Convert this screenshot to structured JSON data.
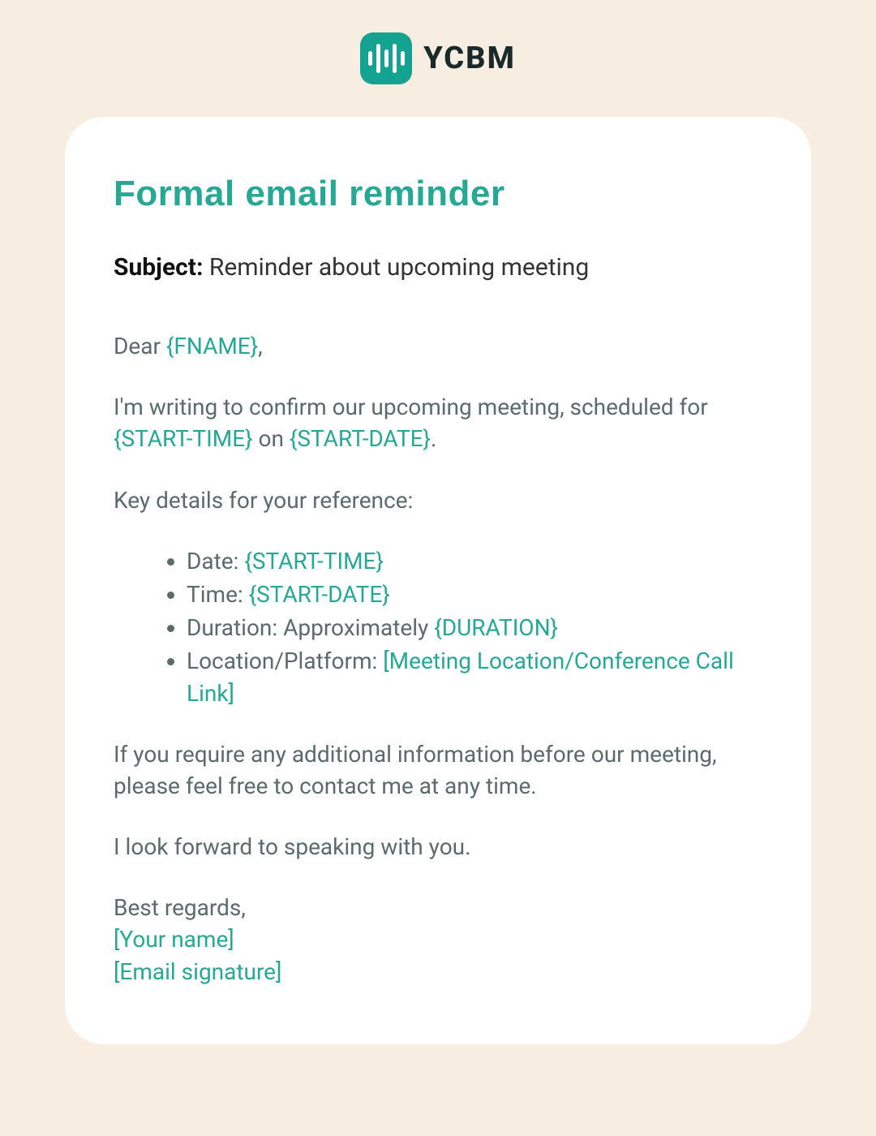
{
  "branding": {
    "name": "YCBM"
  },
  "heading": "Formal email reminder",
  "subject": {
    "label": "Subject:",
    "value": "Reminder about upcoming meeting"
  },
  "greeting": {
    "prefix": "Dear ",
    "token": "{FNAME}",
    "suffix": ","
  },
  "intro": {
    "part1": "I'm writing to confirm our upcoming meeting, scheduled for ",
    "token1": "{START-TIME}",
    "middle": " on ",
    "token2": "{START-DATE}",
    "suffix": "."
  },
  "details_intro": "Key details for your reference:",
  "details": {
    "date": {
      "label": "Date: ",
      "token": "{START-TIME}"
    },
    "time": {
      "label": "Time: ",
      "token": "{START-DATE}"
    },
    "duration": {
      "label": "Duration: Approximately ",
      "token": "{DURATION}"
    },
    "location": {
      "label": "Location/Platform: ",
      "token": "[Meeting Location/Conference Call Link]"
    }
  },
  "para_additional": "If you require any additional information before our meeting, please feel free to contact me at any time.",
  "para_lookforward": "I look forward to speaking with you.",
  "closing": {
    "regards": "Best regards,",
    "name_token": "[Your name]",
    "signature_token": "[Email signature]"
  }
}
